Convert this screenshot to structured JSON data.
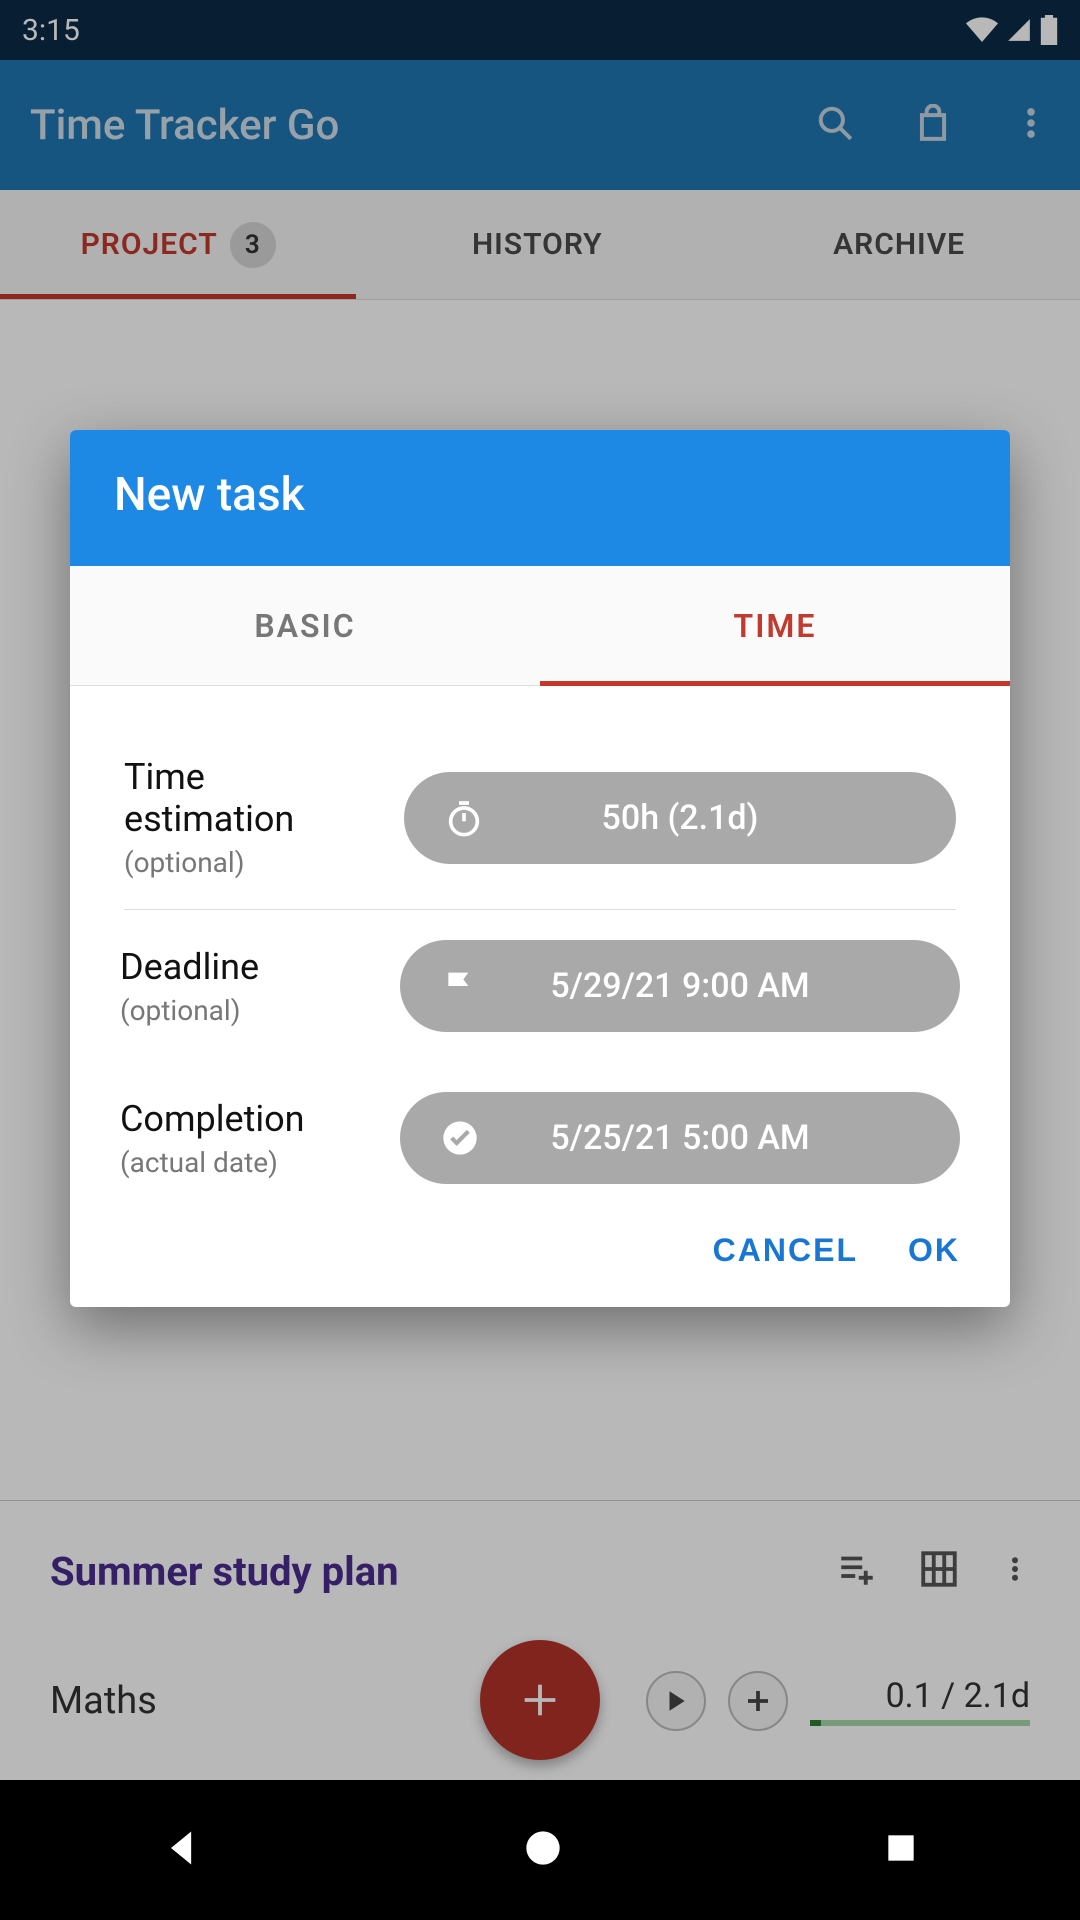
{
  "status": {
    "time": "3:15"
  },
  "app": {
    "title": "Time Tracker Go"
  },
  "tabs": {
    "project": {
      "label": "PROJECT",
      "count": "3"
    },
    "history": {
      "label": "HISTORY"
    },
    "archive": {
      "label": "ARCHIVE"
    }
  },
  "summer": {
    "title": "Summer study plan",
    "task_name": "Maths",
    "progress_text": "0.1 / 2.1d"
  },
  "dialog": {
    "title": "New task",
    "tabs": {
      "basic": "BASIC",
      "time": "TIME"
    },
    "fields": {
      "estimation": {
        "label": "Time estimation",
        "sub": "(optional)",
        "value": "50h (2.1d)"
      },
      "deadline": {
        "label": "Deadline",
        "sub": "(optional)",
        "value": "5/29/21 9:00 AM"
      },
      "completion": {
        "label": "Completion",
        "sub": "(actual date)",
        "value": "5/25/21 5:00 AM"
      }
    },
    "actions": {
      "cancel": "CANCEL",
      "ok": "OK"
    }
  }
}
